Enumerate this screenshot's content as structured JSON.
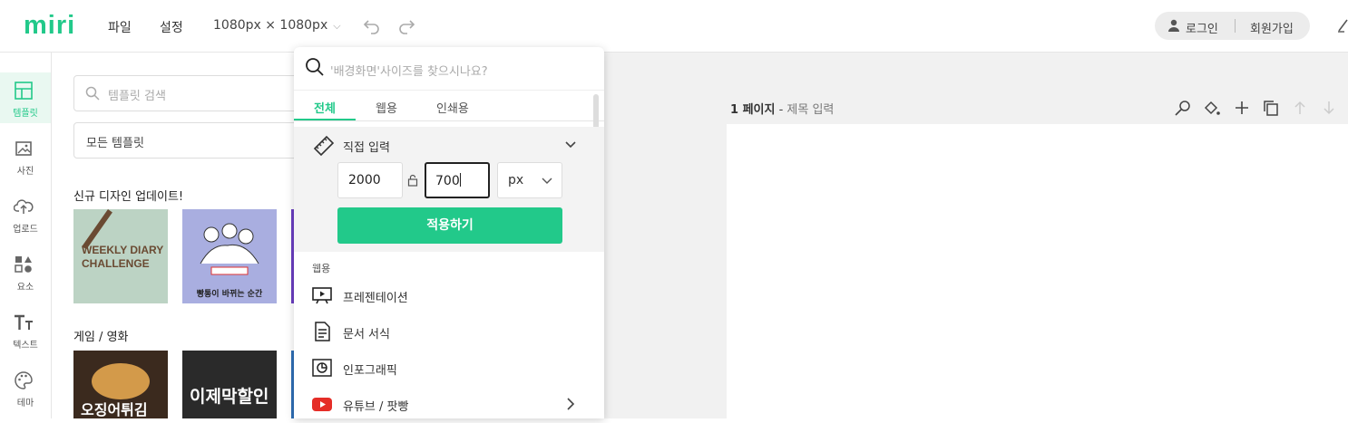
{
  "topbar": {
    "logo": "miri",
    "menu": [
      "파일",
      "설정"
    ],
    "size_selector": "1080px × 1080px",
    "login": "로그인",
    "signup": "회원가입"
  },
  "rail": [
    {
      "label": "템플릿",
      "icon": "layout-icon",
      "active": true
    },
    {
      "label": "사진",
      "icon": "image-icon",
      "active": false
    },
    {
      "label": "업로드",
      "icon": "upload-cloud-icon",
      "active": false
    },
    {
      "label": "요소",
      "icon": "elements-icon",
      "active": false
    },
    {
      "label": "텍스트",
      "icon": "text-icon",
      "active": false
    },
    {
      "label": "테마",
      "icon": "palette-icon",
      "active": false
    }
  ],
  "panel": {
    "search_placeholder": "템플릿 검색",
    "filter_value": "모든 템플릿",
    "section_new": "신규 디자인 업데이트!",
    "section_game": "게임 / 영화",
    "thumbs_new": [
      {
        "line1": "WEEKLY DIARY",
        "line2": "CHALLENGE"
      },
      {
        "line1": "",
        "line2": "빵통이 바뀌는 순간"
      }
    ],
    "thumbs_game": [
      {
        "line1": "오징어튀김"
      },
      {
        "line1": "이제막할인"
      }
    ]
  },
  "dropdown": {
    "search_placeholder": "'배경화면'사이즈를 찾으시나요?",
    "tabs": [
      "전체",
      "웹용",
      "인쇄용"
    ],
    "custom_title": "직접 입력",
    "width": "2000",
    "height": "700",
    "unit": "px",
    "apply": "적용하기",
    "group_label": "웹용",
    "options": [
      {
        "label": "프레젠테이션",
        "icon": "presentation-icon"
      },
      {
        "label": "문서 서식",
        "icon": "document-icon"
      },
      {
        "label": "인포그래픽",
        "icon": "infographic-icon"
      },
      {
        "label": "유튜브 / 팟빵",
        "icon": "youtube-icon",
        "has_arrow": true
      }
    ]
  },
  "editor": {
    "page_label": "1 페이지",
    "page_sep": " - ",
    "title_placeholder": "제목 입력"
  },
  "colors": {
    "accent": "#22c98a",
    "canvas_bg": "#f1f1f1"
  }
}
